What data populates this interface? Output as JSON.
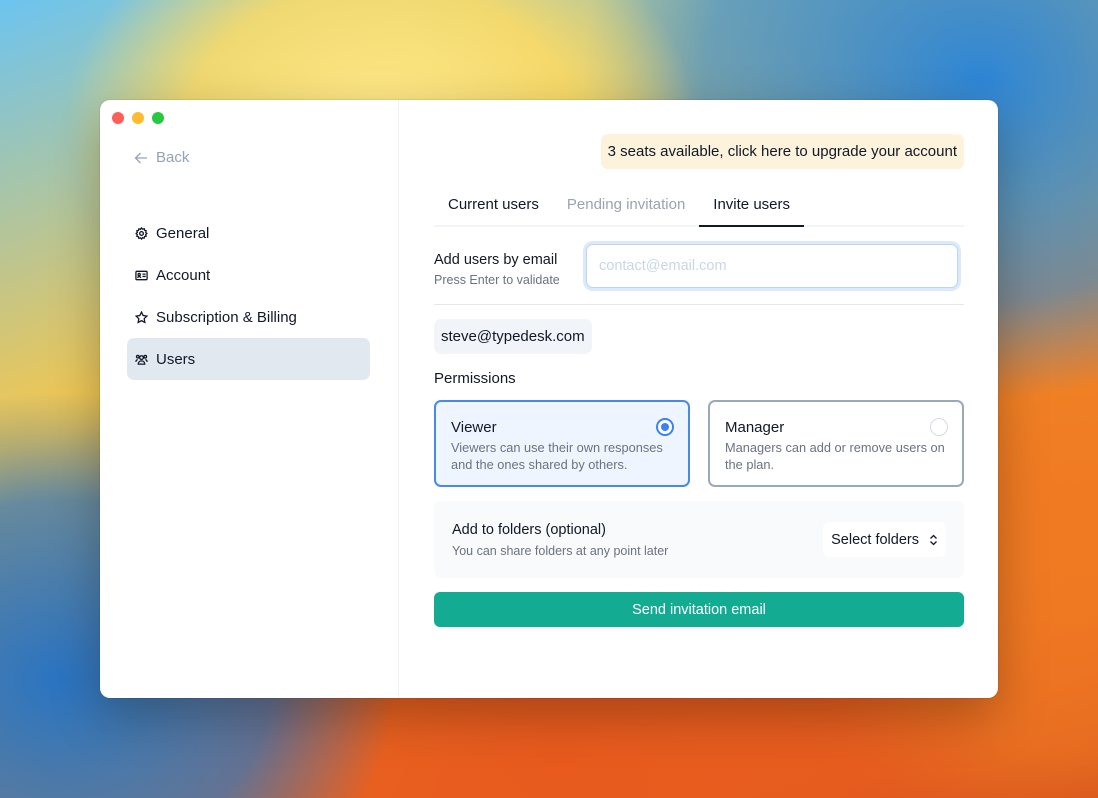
{
  "window": {
    "traffic_lights": [
      "close",
      "minimize",
      "maximize"
    ]
  },
  "sidebar": {
    "back_label": "Back",
    "back_icon": "arrow-left-icon",
    "items": [
      {
        "label": "General",
        "icon": "gear-icon",
        "active": false
      },
      {
        "label": "Account",
        "icon": "id-card-icon",
        "active": false
      },
      {
        "label": "Subscription & Billing",
        "icon": "star-icon",
        "active": false
      },
      {
        "label": "Users",
        "icon": "users-icon",
        "active": true
      }
    ]
  },
  "main": {
    "upgrade_banner": "3 seats available, click here to upgrade your account",
    "tabs": [
      {
        "label": "Current users",
        "state": "normal"
      },
      {
        "label": "Pending invitation",
        "state": "muted"
      },
      {
        "label": "Invite users",
        "state": "active"
      }
    ],
    "email": {
      "label": "Add users by email",
      "hint": "Press Enter to validate",
      "value": "",
      "placeholder": "contact@email.com"
    },
    "added_emails": [
      "steve@typedesk.com"
    ],
    "permissions": {
      "title": "Permissions",
      "options": [
        {
          "title": "Viewer",
          "description": "Viewers can use their own responses and the ones shared by others.",
          "selected": true
        },
        {
          "title": "Manager",
          "description": "Managers can add or remove users on the plan.",
          "selected": false
        }
      ]
    },
    "folders": {
      "title": "Add to folders (optional)",
      "hint": "You can share folders at any point later",
      "select_label": "Select folders",
      "select_icon": "chevron-up-down-icon"
    },
    "send_button": "Send invitation email"
  },
  "colors": {
    "accent_button": "#14ab93",
    "selected_card_border": "#4a89e8",
    "banner_background": "#fdf3dc",
    "active_nav_background": "#e2e8f0"
  }
}
